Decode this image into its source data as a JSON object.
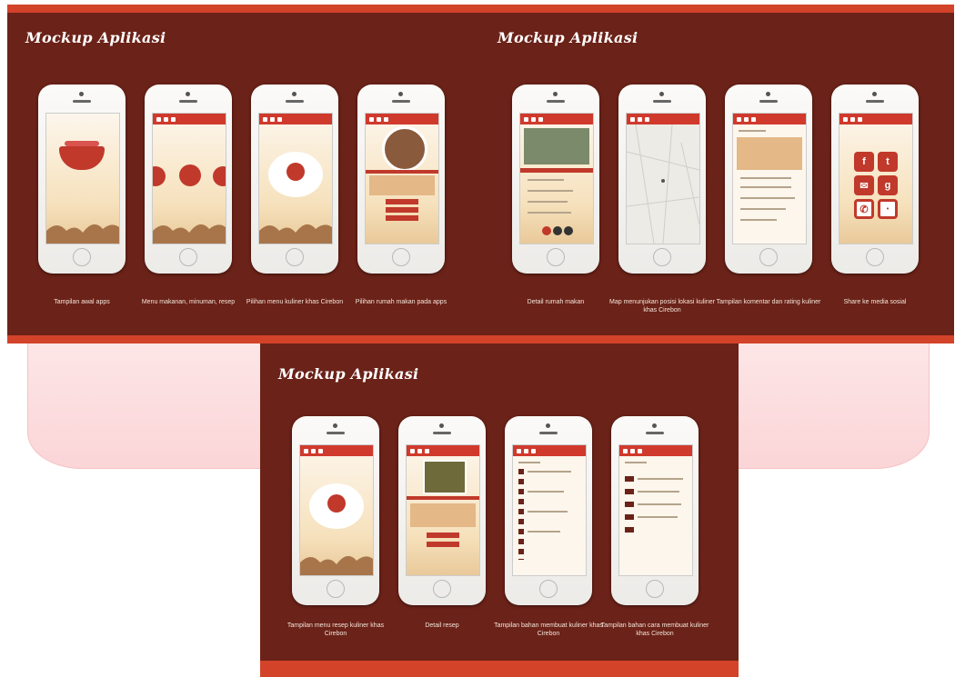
{
  "panels": [
    {
      "title": "Mockup Aplikasi",
      "captions": [
        "Tampilan awal apps",
        "Menu makanan, minuman, resep",
        "Pilihan menu kuliner khas Cirebon",
        "Pilihan rumah makan pada apps"
      ]
    },
    {
      "title": "Mockup Aplikasi",
      "captions": [
        "Detail rumah makan",
        "Map menunjukan posisi lokasi kuliner khas Cirebon",
        "Tampilan komentar dan rating kuliner",
        "Share ke media sosial"
      ]
    },
    {
      "title": "Mockup Aplikasi",
      "captions": [
        "Tampilan menu resep kuliner khas Cirebon",
        "Detail resep",
        "Tampilan bahan membuat kuliner khas Cirebon",
        "Tampilan bahan cara membuat kuliner khas Cirebon"
      ]
    }
  ],
  "colors": {
    "panel_bg": "#6b2218",
    "accent": "#d2432a",
    "pink_band": "#fbd5d7"
  },
  "icons": [
    "facebook-icon",
    "twitter-icon",
    "email-icon",
    "google-plus-icon",
    "phone-icon",
    "line-icon"
  ]
}
